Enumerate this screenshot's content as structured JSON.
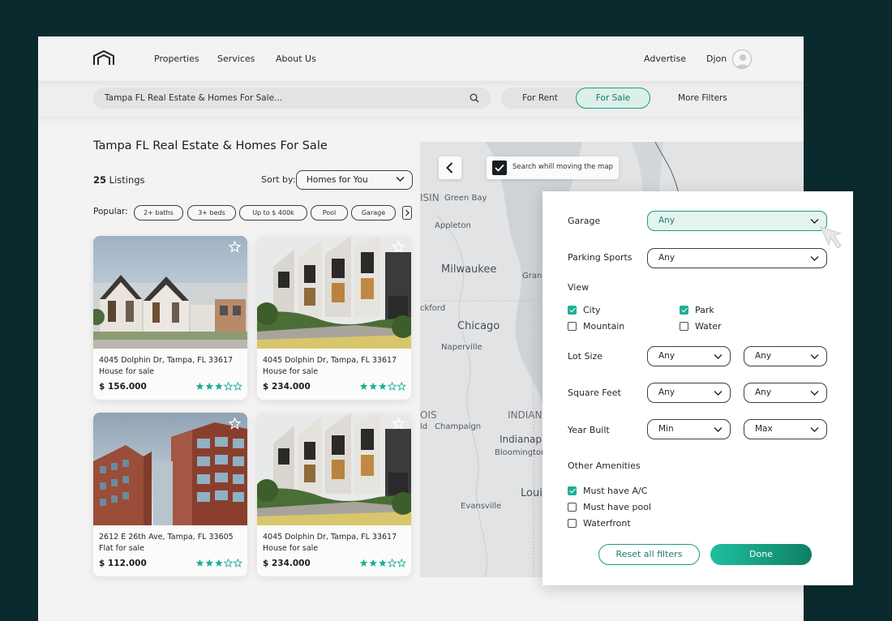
{
  "colors": {
    "accent": "#1a9b85",
    "accent_dark": "#0f7f65",
    "frame_bg": "#0b2a2e",
    "star": "#1fae94"
  },
  "header": {
    "logo": "house-logo-icon",
    "nav": [
      "Properties",
      "Services",
      "About Us"
    ],
    "advertise": "Advertise",
    "user_name": "Djon"
  },
  "searchbar": {
    "query": "Tampa FL Real Estate & Homes For Sale...",
    "toggle": [
      {
        "label": "For Rent",
        "active": false
      },
      {
        "label": "For Sale",
        "active": true
      }
    ],
    "more_filters": "More Filters"
  },
  "listings": {
    "title": "Tampa FL Real Estate & Homes For Sale",
    "count": "25",
    "count_label": "Listings",
    "sort_label": "Sort by:",
    "sort_value": "Homes for You",
    "popular_label": "Popular:",
    "chips": [
      "2+ baths",
      "3+ beds",
      "Up to $ 400k",
      "Pool",
      "Garage"
    ],
    "cards": [
      {
        "address": "4045 Dolphin Dr, Tampa, FL 33617",
        "type": "House for sale",
        "price": "$  156.000",
        "rating": 3,
        "image": "gabled-houses"
      },
      {
        "address": "4045 Dolphin Dr, Tampa, FL 33617",
        "type": "House for sale",
        "price": "$  234.000",
        "rating": 3,
        "image": "townhouses"
      },
      {
        "address": "2612 E 26th Ave, Tampa, FL 33605",
        "type": "Flat for sale",
        "price": "$  112.000",
        "rating": 3,
        "image": "apartment-tower"
      },
      {
        "address": "4045 Dolphin Dr, Tampa, FL 33617",
        "type": "House for sale",
        "price": "$  234.000",
        "rating": 3,
        "image": "townhouses"
      }
    ]
  },
  "map": {
    "search_toggle_label": "Search whill moving the map",
    "search_toggle_checked": true,
    "labels": [
      "ISIN",
      "Green Bay",
      "Appleton",
      "Milwaukee",
      "Gran",
      "ckford",
      "Chicago",
      "Naperville",
      "OIS",
      "ld",
      "Champaign",
      "INDIAN",
      "Indianap",
      "Bloomington",
      "Louis",
      "Evansville"
    ]
  },
  "filters": {
    "garage": {
      "label": "Garage",
      "value": "Any"
    },
    "parking": {
      "label": "Parking Sports",
      "value": "Any"
    },
    "view": {
      "label": "View",
      "options": [
        {
          "label": "City",
          "checked": true
        },
        {
          "label": "Park",
          "checked": true
        },
        {
          "label": "Mountain",
          "checked": false
        },
        {
          "label": "Water",
          "checked": false
        }
      ]
    },
    "lot_size": {
      "label": "Lot Size",
      "min": "Any",
      "max": "Any"
    },
    "square_feet": {
      "label": "Square Feet",
      "min": "Any",
      "max": "Any"
    },
    "year_built": {
      "label": "Year Built",
      "min": "Min",
      "max": "Max"
    },
    "amenities": {
      "label": "Other Amenities",
      "options": [
        {
          "label": "Must have A/C",
          "checked": true
        },
        {
          "label": "Must have pool",
          "checked": false
        },
        {
          "label": "Waterfront",
          "checked": false
        }
      ]
    },
    "reset_label": "Reset all filters",
    "done_label": "Done"
  }
}
